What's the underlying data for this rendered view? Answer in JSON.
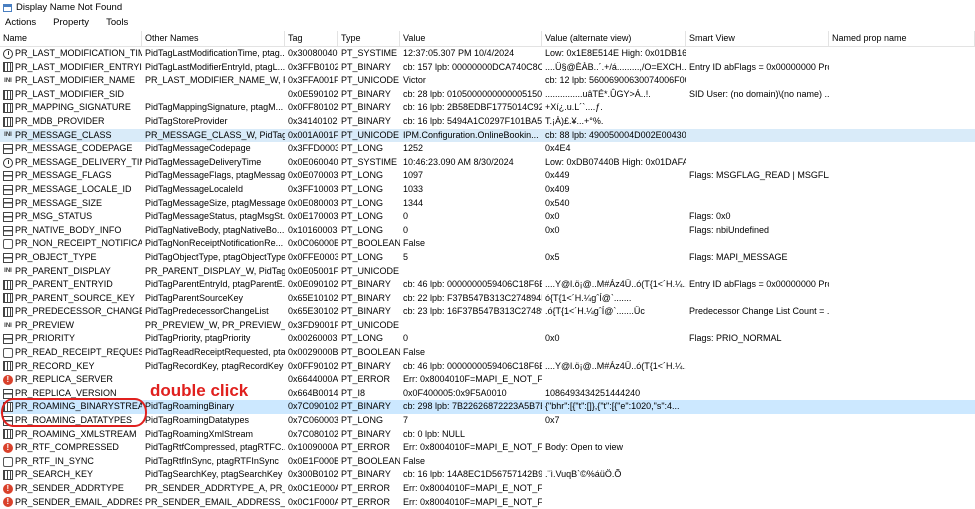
{
  "window": {
    "title": "Display Name Not Found"
  },
  "menu": [
    "Actions",
    "Property",
    "Tools"
  ],
  "columns": [
    "Name",
    "Other Names",
    "Tag",
    "Type",
    "Value",
    "Value (alternate view)",
    "Smart View",
    "Named prop name"
  ],
  "rows": [
    {
      "icon": "clock",
      "name": "PR_LAST_MODIFICATION_TIME",
      "other": "PidTagLastModificationTime, ptag...",
      "tag": "0x30080040",
      "type": "PT_SYSTIME",
      "value": "12:37:05.307 PM 10/4/2024",
      "alt": "Low: 0x1E8E514E High: 0x01DB165A",
      "smart": "",
      "named": ""
    },
    {
      "icon": "bin",
      "name": "PR_LAST_MODIFIER_ENTRYID",
      "other": "PidTagLastModifierEntryId, ptagL...",
      "tag": "0x3FFB0102",
      "type": "PT_BINARY",
      "value": "cb: 157 lpb: 00000000DCA740C8C...",
      "alt": "....Ü§@ÈÀB..´.+/á.........,/O=EXCH...",
      "smart": "Entry ID abFlags = 0x00000000 Pro...",
      "named": ""
    },
    {
      "icon": "text",
      "name": "PR_LAST_MODIFIER_NAME",
      "other": "PR_LAST_MODIFIER_NAME_W, Pi...",
      "tag": "0x3FFA001F",
      "type": "PT_UNICODE",
      "value": "Victor",
      "alt": "cb: 12 lpb: 56006900630074006F00...",
      "smart": "",
      "named": ""
    },
    {
      "icon": "bin",
      "name": "PR_LAST_MODIFIER_SID",
      "other": "",
      "tag": "0x0E590102",
      "type": "PT_BINARY",
      "value": "cb: 28 lpb: 01050000000000051500...",
      "alt": "...............uâTÉ*.ÛGY>Á..!.",
      "smart": "SID User: (no domain)\\(no name) ...",
      "named": ""
    },
    {
      "icon": "bin",
      "name": "PR_MAPPING_SIGNATURE",
      "other": "PidTagMappingSignature, ptagM...",
      "tag": "0x0FF80102",
      "type": "PT_BINARY",
      "value": "cb: 16 lpb: 2B58EDBF1775014C92B...",
      "alt": "+Xí¿.u.L´`....ƒ.",
      "smart": "",
      "named": ""
    },
    {
      "icon": "bin",
      "name": "PR_MDB_PROVIDER",
      "other": "PidTagStoreProvider",
      "tag": "0x34140102",
      "type": "PT_BINARY",
      "value": "cb: 16 lpb: 5494A1C0297F101BA58...",
      "alt": "T.¡À)£.¥...+°%.",
      "smart": "",
      "named": ""
    },
    {
      "icon": "text",
      "name": "PR_MESSAGE_CLASS",
      "other": "PR_MESSAGE_CLASS_W, PidTagM...",
      "tag": "0x001A001F",
      "type": "PT_UNICODE",
      "value": "IPM.Configuration.OnlineBookin...",
      "alt": "cb: 88 lpb: 490050004D002E004300...",
      "smart": "",
      "named": "",
      "sel": "sel2"
    },
    {
      "icon": "num",
      "name": "PR_MESSAGE_CODEPAGE",
      "other": "PidTagMessageCodepage",
      "tag": "0x3FFD0003",
      "type": "PT_LONG",
      "value": "1252",
      "alt": "0x4E4",
      "smart": "",
      "named": ""
    },
    {
      "icon": "clock",
      "name": "PR_MESSAGE_DELIVERY_TIME",
      "other": "PidTagMessageDeliveryTime",
      "tag": "0x0E060040",
      "type": "PT_SYSTIME",
      "value": "10:46:23.090 AM 8/30/2024",
      "alt": "Low: 0xDB07440B High: 0x01DAFA...",
      "smart": "",
      "named": ""
    },
    {
      "icon": "num",
      "name": "PR_MESSAGE_FLAGS",
      "other": "PidTagMessageFlags, ptagMessag...",
      "tag": "0x0E070003",
      "type": "PT_LONG",
      "value": "1097",
      "alt": "0x449",
      "smart": "Flags: MSGFLAG_READ | MSGFLA...",
      "named": ""
    },
    {
      "icon": "num",
      "name": "PR_MESSAGE_LOCALE_ID",
      "other": "PidTagMessageLocaleId",
      "tag": "0x3FF10003",
      "type": "PT_LONG",
      "value": "1033",
      "alt": "0x409",
      "smart": "",
      "named": ""
    },
    {
      "icon": "num",
      "name": "PR_MESSAGE_SIZE",
      "other": "PidTagMessageSize, ptagMessage...",
      "tag": "0x0E080003",
      "type": "PT_LONG",
      "value": "1344",
      "alt": "0x540",
      "smart": "",
      "named": ""
    },
    {
      "icon": "num",
      "name": "PR_MSG_STATUS",
      "other": "PidTagMessageStatus, ptagMsgSt...",
      "tag": "0x0E170003",
      "type": "PT_LONG",
      "value": "0",
      "alt": "0x0",
      "smart": "Flags: 0x0",
      "named": ""
    },
    {
      "icon": "num",
      "name": "PR_NATIVE_BODY_INFO",
      "other": "PidTagNativeBody, ptagNativeBo...",
      "tag": "0x10160003",
      "type": "PT_LONG",
      "value": "0",
      "alt": "0x0",
      "smart": "Flags: nbiUndefined",
      "named": ""
    },
    {
      "icon": "bool",
      "name": "PR_NON_RECEIPT_NOTIFICATI...",
      "other": "PidTagNonReceiptNotificationRe...",
      "tag": "0x0C06000B",
      "type": "PT_BOOLEAN",
      "value": "False",
      "alt": "",
      "smart": "",
      "named": ""
    },
    {
      "icon": "num",
      "name": "PR_OBJECT_TYPE",
      "other": "PidTagObjectType, ptagObjectType",
      "tag": "0x0FFE0003",
      "type": "PT_LONG",
      "value": "5",
      "alt": "0x5",
      "smart": "Flags: MAPI_MESSAGE",
      "named": ""
    },
    {
      "icon": "text",
      "name": "PR_PARENT_DISPLAY",
      "other": "PR_PARENT_DISPLAY_W, PidTagP...",
      "tag": "0x0E05001F",
      "type": "PT_UNICODE",
      "value": "",
      "alt": "",
      "smart": "",
      "named": ""
    },
    {
      "icon": "bin",
      "name": "PR_PARENT_ENTRYID",
      "other": "PidTagParentEntryId, ptagParentE...",
      "tag": "0x0E090102",
      "type": "PT_BINARY",
      "value": "cb: 46 lpb: 0000000059406C18F6B...",
      "alt": "....Y@l.ö¡@..M#Áz4Ü..ó(T{1<´H.¼...",
      "smart": "Entry ID abFlags = 0x00000000 Pro...",
      "named": ""
    },
    {
      "icon": "bin",
      "name": "PR_PARENT_SOURCE_KEY",
      "other": "PidTagParentSourceKey",
      "tag": "0x65E10102",
      "type": "PT_BINARY",
      "value": "cb: 22 lpb: F37B547B313C274894B...",
      "alt": "ó{T{1<´H.¼gˆÍ@`.......",
      "smart": "",
      "named": ""
    },
    {
      "icon": "bin",
      "name": "PR_PREDECESSOR_CHANGE_LIST",
      "other": "PidTagPredecessorChangeList",
      "tag": "0x65E30102",
      "type": "PT_BINARY",
      "value": "cb: 23 lpb: 16F37B547B313C27489...",
      "alt": ".ó{T{1<´H.¼gˆÍ@`.......Üc",
      "smart": "Predecessor Change List Count = ...",
      "named": ""
    },
    {
      "icon": "text",
      "name": "PR_PREVIEW",
      "other": "PR_PREVIEW_W, PR_PREVIEW_A",
      "tag": "0x3FD9001F",
      "type": "PT_UNICODE",
      "value": "",
      "alt": "",
      "smart": "",
      "named": ""
    },
    {
      "icon": "num",
      "name": "PR_PRIORITY",
      "other": "PidTagPriority, ptagPriority",
      "tag": "0x00260003",
      "type": "PT_LONG",
      "value": "0",
      "alt": "0x0",
      "smart": "Flags: PRIO_NORMAL",
      "named": ""
    },
    {
      "icon": "bool",
      "name": "PR_READ_RECEIPT_REQUESTED",
      "other": "PidTagReadReceiptRequested, pta...",
      "tag": "0x0029000B",
      "type": "PT_BOOLEAN",
      "value": "False",
      "alt": "",
      "smart": "",
      "named": ""
    },
    {
      "icon": "bin",
      "name": "PR_RECORD_KEY",
      "other": "PidTagRecordKey, ptagRecordKey",
      "tag": "0x0FF90102",
      "type": "PT_BINARY",
      "value": "cb: 46 lpb: 0000000059406C18F6B...",
      "alt": "....Y@l.ö¡@..M#Áz4Ü..ó(T{1<´H.¼...",
      "smart": "",
      "named": ""
    },
    {
      "icon": "err",
      "name": "PR_REPLICA_SERVER",
      "other": "",
      "tag": "0x6644000A",
      "type": "PT_ERROR",
      "value": "Err: 0x8004010F=MAPI_E_NOT_FO...",
      "alt": "",
      "smart": "",
      "named": ""
    },
    {
      "icon": "num",
      "name": "PR_REPLICA_VERSION",
      "other": "",
      "tag": "0x664B0014",
      "type": "PT_I8",
      "value": "0x0F400005:0x9F5A0010",
      "alt": "1086493434251444240",
      "smart": "",
      "named": ""
    },
    {
      "icon": "bin",
      "name": "PR_ROAMING_BINARYSTREAM",
      "other": "PidTagRoamingBinary",
      "tag": "0x7C090102",
      "type": "PT_BINARY",
      "value": "cb: 298 lpb: 7B22626872223A5B7B...",
      "alt": "{\"bhr\":[{\"t\":[]},{\"t\":[{\"e\":1020,\"s\":4...",
      "smart": "",
      "named": "",
      "sel": "sel"
    },
    {
      "icon": "num",
      "name": "PR_ROAMING_DATATYPES",
      "other": "PidTagRoamingDatatypes",
      "tag": "0x7C060003",
      "type": "PT_LONG",
      "value": "7",
      "alt": "0x7",
      "smart": "",
      "named": ""
    },
    {
      "icon": "bin",
      "name": "PR_ROAMING_XMLSTREAM",
      "other": "PidTagRoamingXmlStream",
      "tag": "0x7C080102",
      "type": "PT_BINARY",
      "value": "cb: 0 lpb: NULL",
      "alt": "",
      "smart": "",
      "named": ""
    },
    {
      "icon": "err",
      "name": "PR_RTF_COMPRESSED",
      "other": "PidTagRtfCompressed, ptagRTFC...",
      "tag": "0x1009000A",
      "type": "PT_ERROR",
      "value": "Err: 0x8004010F=MAPI_E_NOT_FO...",
      "alt": "Body: Open to view",
      "smart": "",
      "named": ""
    },
    {
      "icon": "bool",
      "name": "PR_RTF_IN_SYNC",
      "other": "PidTagRtfInSync, ptagRTFInSync",
      "tag": "0x0E1F000B",
      "type": "PT_BOOLEAN",
      "value": "False",
      "alt": "",
      "smart": "",
      "named": ""
    },
    {
      "icon": "bin",
      "name": "PR_SEARCH_KEY",
      "other": "PidTagSearchKey, ptagSearchKey",
      "tag": "0x300B0102",
      "type": "PT_BINARY",
      "value": "cb: 16 lpb: 14A8EC1D56757142B9...",
      "alt": ".¨ì.VuqB`©%áüÖ.Õ",
      "smart": "",
      "named": ""
    },
    {
      "icon": "err",
      "name": "PR_SENDER_ADDRTYPE",
      "other": "PR_SENDER_ADDRTYPE_A, PR_SE...",
      "tag": "0x0C1E000A",
      "type": "PT_ERROR",
      "value": "Err: 0x8004010F=MAPI_E_NOT_FO...",
      "alt": "",
      "smart": "",
      "named": ""
    },
    {
      "icon": "err",
      "name": "PR_SENDER_EMAIL_ADDRESS",
      "other": "PR_SENDER_EMAIL_ADDRESS_A...",
      "tag": "0x0C1F000A",
      "type": "PT_ERROR",
      "value": "Err: 0x8004010F=MAPI_E_NOT_FO...",
      "alt": "",
      "smart": "",
      "named": ""
    }
  ],
  "annotation": {
    "label": "double click"
  },
  "colors": {
    "selected": "#cce8ff",
    "annotation": "#e0201e"
  }
}
